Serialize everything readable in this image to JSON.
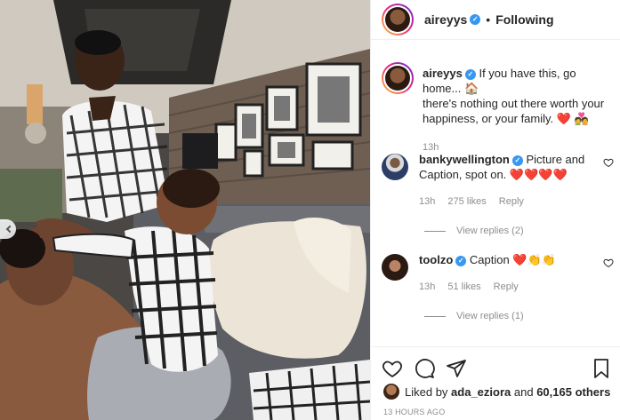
{
  "post": {
    "author": "aireyys",
    "header_separator": "•",
    "follow_state": "Following"
  },
  "caption": {
    "username": "aireyys",
    "text_line1": "If you have this, go home...",
    "text_rest": "there's nothing out there worth your happiness, or your family.",
    "time": "13h"
  },
  "comments": [
    {
      "username": "bankywellington",
      "text": "Picture and Caption, spot on.",
      "emoji": "❤️❤️❤️❤️",
      "time": "13h",
      "likes": "275 likes",
      "reply": "Reply",
      "view_replies": "View replies (2)"
    },
    {
      "username": "toolzo",
      "text": "Caption",
      "emoji": "❤️👏👏",
      "time": "13h",
      "likes": "51 likes",
      "reply": "Reply",
      "view_replies": "View replies (1)"
    }
  ],
  "footer": {
    "liked_by_prefix": "Liked by",
    "liked_by_user": "ada_eziora",
    "liked_by_and": "and",
    "liked_by_count": "60,165 others",
    "posted_ago": "13 HOURS AGO"
  },
  "icons": {
    "like": "heart-outline-icon",
    "comment": "comment-bubble-icon",
    "share": "paper-plane-icon",
    "save": "bookmark-icon",
    "verified": "verified-badge-icon",
    "carousel_prev": "chevron-left-icon"
  },
  "colors": {
    "verified": "#3897f0",
    "heart": "#ed4956",
    "muted": "#8e8e8e",
    "text": "#262626"
  }
}
